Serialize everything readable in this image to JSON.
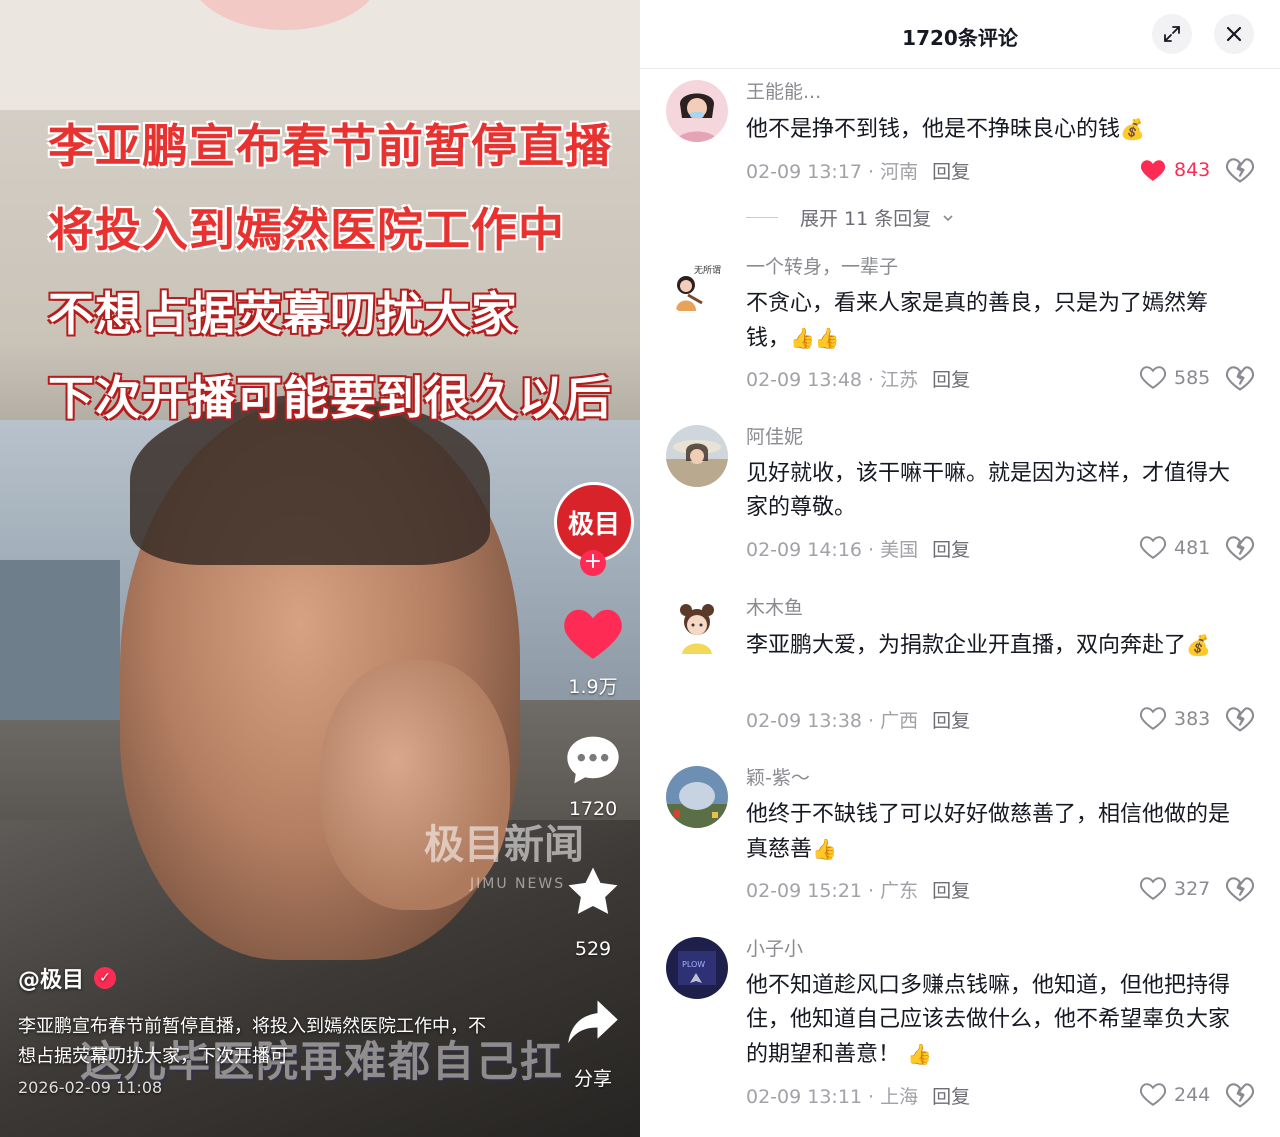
{
  "video": {
    "headline_lines": [
      {
        "text": "李亚鹏宣布春节前暂停直播",
        "style": "red"
      },
      {
        "text": "将投入到嫣然医院工作中",
        "style": "red"
      },
      {
        "text": "不想占据荧幕叨扰大家",
        "style": "white"
      },
      {
        "text": "下次开播可能要到很久以后",
        "style": "white"
      }
    ],
    "watermark": "极目新闻",
    "watermark_sub": "JIMU NEWS",
    "channel_avatar_text": "极目",
    "follow_symbol": "+",
    "likes": "1.9万",
    "comments": "1720",
    "favorites": "529",
    "share_label": "分享",
    "author": "@极目",
    "description": "李亚鹏宣布春节前暂停直播，将投入到嫣然医院工作中，不想占据荧幕叨扰大家，下次开播可",
    "date": "2026-02-09 11:08",
    "burned_subtitle": "这儿毕医院再难都自己扛",
    "like_color": "#fe2c55"
  },
  "panel": {
    "title": "1720条评论",
    "expand_icon": "expand-icon",
    "close_icon": "close-icon"
  },
  "comments": [
    {
      "name": "王能能...",
      "text": "他不是挣不到钱，他是不挣昧良心的钱",
      "emoji": "💰",
      "time": "02-09 13:17",
      "region": "河南",
      "reply": "回复",
      "likes": "843",
      "liked": true,
      "expand": "展开 11 条回复"
    },
    {
      "name": "一个转身，一辈子",
      "text": "不贪心，看来人家是真的善良，只是为了嫣然筹钱，",
      "emoji": "👍👍",
      "time": "02-09 13:48",
      "region": "江苏",
      "reply": "回复",
      "likes": "585",
      "liked": false
    },
    {
      "name": "阿佳妮",
      "text": "见好就收，该干嘛干嘛。就是因为这样，才值得大家的尊敬。",
      "emoji": "",
      "time": "02-09 14:16",
      "region": "美国",
      "reply": "回复",
      "likes": "481",
      "liked": false
    },
    {
      "name": "木木鱼",
      "text": "李亚鹏大爱，为捐款企业开直播，双向奔赴了",
      "emoji": "💰",
      "time": "02-09 13:38",
      "region": "广西",
      "reply": "回复",
      "likes": "383",
      "liked": false
    },
    {
      "name": "颖-紫～",
      "text": "他终于不缺钱了可以好好做慈善了，相信他做的是真慈善",
      "emoji": "👍",
      "time": "02-09 15:21",
      "region": "广东",
      "reply": "回复",
      "likes": "327",
      "liked": false
    },
    {
      "name": "小子小",
      "text": "他不知道趁风口多赚点钱嘛，他知道，但他把持得住，他知道自己应该去做什么，他不希望辜负大家的期望和善意！",
      "emoji": "👍",
      "time": "02-09 13:11",
      "region": "上海",
      "reply": "回复",
      "likes": "244",
      "liked": false
    }
  ]
}
